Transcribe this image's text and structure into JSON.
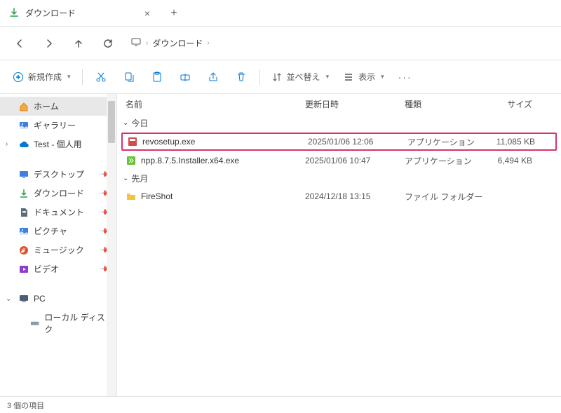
{
  "tab": {
    "title": "ダウンロード"
  },
  "breadcrumb": {
    "item": "ダウンロード"
  },
  "toolbar": {
    "new": "新規作成",
    "sort": "並べ替え",
    "view": "表示"
  },
  "sidebar": {
    "home": "ホーム",
    "gallery": "ギャラリー",
    "test": "Test - 個人用",
    "desktop": "デスクトップ",
    "downloads": "ダウンロード",
    "documents": "ドキュメント",
    "pictures": "ピクチャ",
    "music": "ミュージック",
    "videos": "ビデオ",
    "pc": "PC",
    "localdisk": "ローカル ディスク"
  },
  "columns": {
    "name": "名前",
    "date": "更新日時",
    "type": "種類",
    "size": "サイズ"
  },
  "groups": {
    "today": "今日",
    "lastmonth": "先月"
  },
  "files": {
    "f1": {
      "name": "revosetup.exe",
      "date": "2025/01/06 12:06",
      "type": "アプリケーション",
      "size": "11,085 KB"
    },
    "f2": {
      "name": "npp.8.7.5.Installer.x64.exe",
      "date": "2025/01/06 10:47",
      "type": "アプリケーション",
      "size": "6,494 KB"
    },
    "f3": {
      "name": "FireShot",
      "date": "2024/12/18 13:15",
      "type": "ファイル フォルダー",
      "size": ""
    }
  },
  "status": "3 個の項目"
}
